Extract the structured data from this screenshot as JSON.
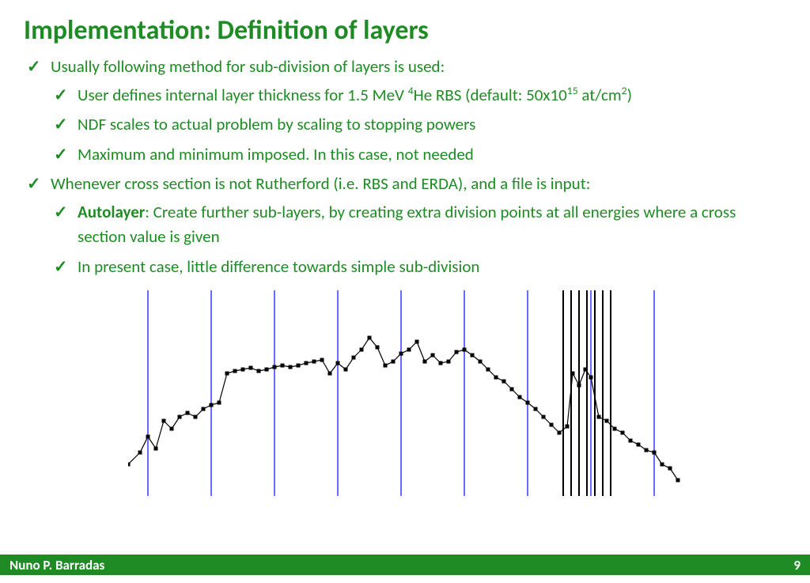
{
  "title": "Implementation: Definition of layers",
  "bullets": {
    "b1": "Usually following method for sub-division of layers is used:",
    "b1a_pre": "User defines internal layer thickness for 1.5 MeV ",
    "b1a_sup1": "4",
    "b1a_mid": "He RBS (default: 50x10",
    "b1a_sup2": "15",
    "b1a_mid2": " at/cm",
    "b1a_sup3": "2",
    "b1a_end": ")",
    "b1b": "NDF scales to actual problem by scaling to stopping powers",
    "b1c": "Maximum and minimum imposed. In this case, not needed",
    "b2": "Whenever cross section is not Rutherford (i.e. RBS and ERDA), and a file is input:",
    "b2a_bold": "Autolayer",
    "b2a_rest": ": Create further sub-layers, by creating extra division points at all energies where a cross section value is given",
    "b2b": "In present case, little difference towards simple sub-division"
  },
  "footer": {
    "author": "Nuno P. Barradas",
    "page": "9"
  },
  "chart_data": {
    "type": "line",
    "title": "",
    "xlabel": "",
    "ylabel": "",
    "x_range": [
      0,
      700
    ],
    "y_range": [
      0,
      260
    ],
    "vlines_blue": [
      25,
      105,
      185,
      265,
      345,
      425,
      505,
      585,
      665
    ],
    "vlines_black": [
      550,
      560,
      570,
      580,
      590,
      600,
      610
    ],
    "series": [
      {
        "name": "cross-section",
        "points": [
          [
            0,
            40
          ],
          [
            15,
            55
          ],
          [
            25,
            75
          ],
          [
            35,
            60
          ],
          [
            45,
            95
          ],
          [
            55,
            85
          ],
          [
            65,
            100
          ],
          [
            75,
            105
          ],
          [
            85,
            100
          ],
          [
            95,
            110
          ],
          [
            105,
            115
          ],
          [
            115,
            118
          ],
          [
            125,
            155
          ],
          [
            135,
            158
          ],
          [
            145,
            160
          ],
          [
            155,
            162
          ],
          [
            165,
            158
          ],
          [
            175,
            160
          ],
          [
            185,
            163
          ],
          [
            195,
            165
          ],
          [
            205,
            163
          ],
          [
            215,
            165
          ],
          [
            225,
            168
          ],
          [
            235,
            170
          ],
          [
            245,
            172
          ],
          [
            255,
            155
          ],
          [
            265,
            168
          ],
          [
            275,
            160
          ],
          [
            285,
            175
          ],
          [
            295,
            185
          ],
          [
            305,
            200
          ],
          [
            315,
            188
          ],
          [
            325,
            165
          ],
          [
            335,
            170
          ],
          [
            345,
            180
          ],
          [
            355,
            185
          ],
          [
            365,
            195
          ],
          [
            375,
            170
          ],
          [
            385,
            178
          ],
          [
            395,
            168
          ],
          [
            405,
            170
          ],
          [
            415,
            182
          ],
          [
            425,
            185
          ],
          [
            435,
            178
          ],
          [
            445,
            170
          ],
          [
            455,
            160
          ],
          [
            465,
            150
          ],
          [
            475,
            145
          ],
          [
            485,
            135
          ],
          [
            495,
            125
          ],
          [
            505,
            118
          ],
          [
            515,
            110
          ],
          [
            525,
            100
          ],
          [
            535,
            90
          ],
          [
            545,
            80
          ],
          [
            555,
            88
          ],
          [
            562,
            155
          ],
          [
            570,
            140
          ],
          [
            578,
            160
          ],
          [
            585,
            150
          ],
          [
            595,
            100
          ],
          [
            605,
            95
          ],
          [
            615,
            85
          ],
          [
            625,
            80
          ],
          [
            635,
            70
          ],
          [
            645,
            65
          ],
          [
            655,
            58
          ],
          [
            665,
            55
          ],
          [
            675,
            40
          ],
          [
            685,
            35
          ],
          [
            695,
            20
          ]
        ]
      }
    ]
  }
}
